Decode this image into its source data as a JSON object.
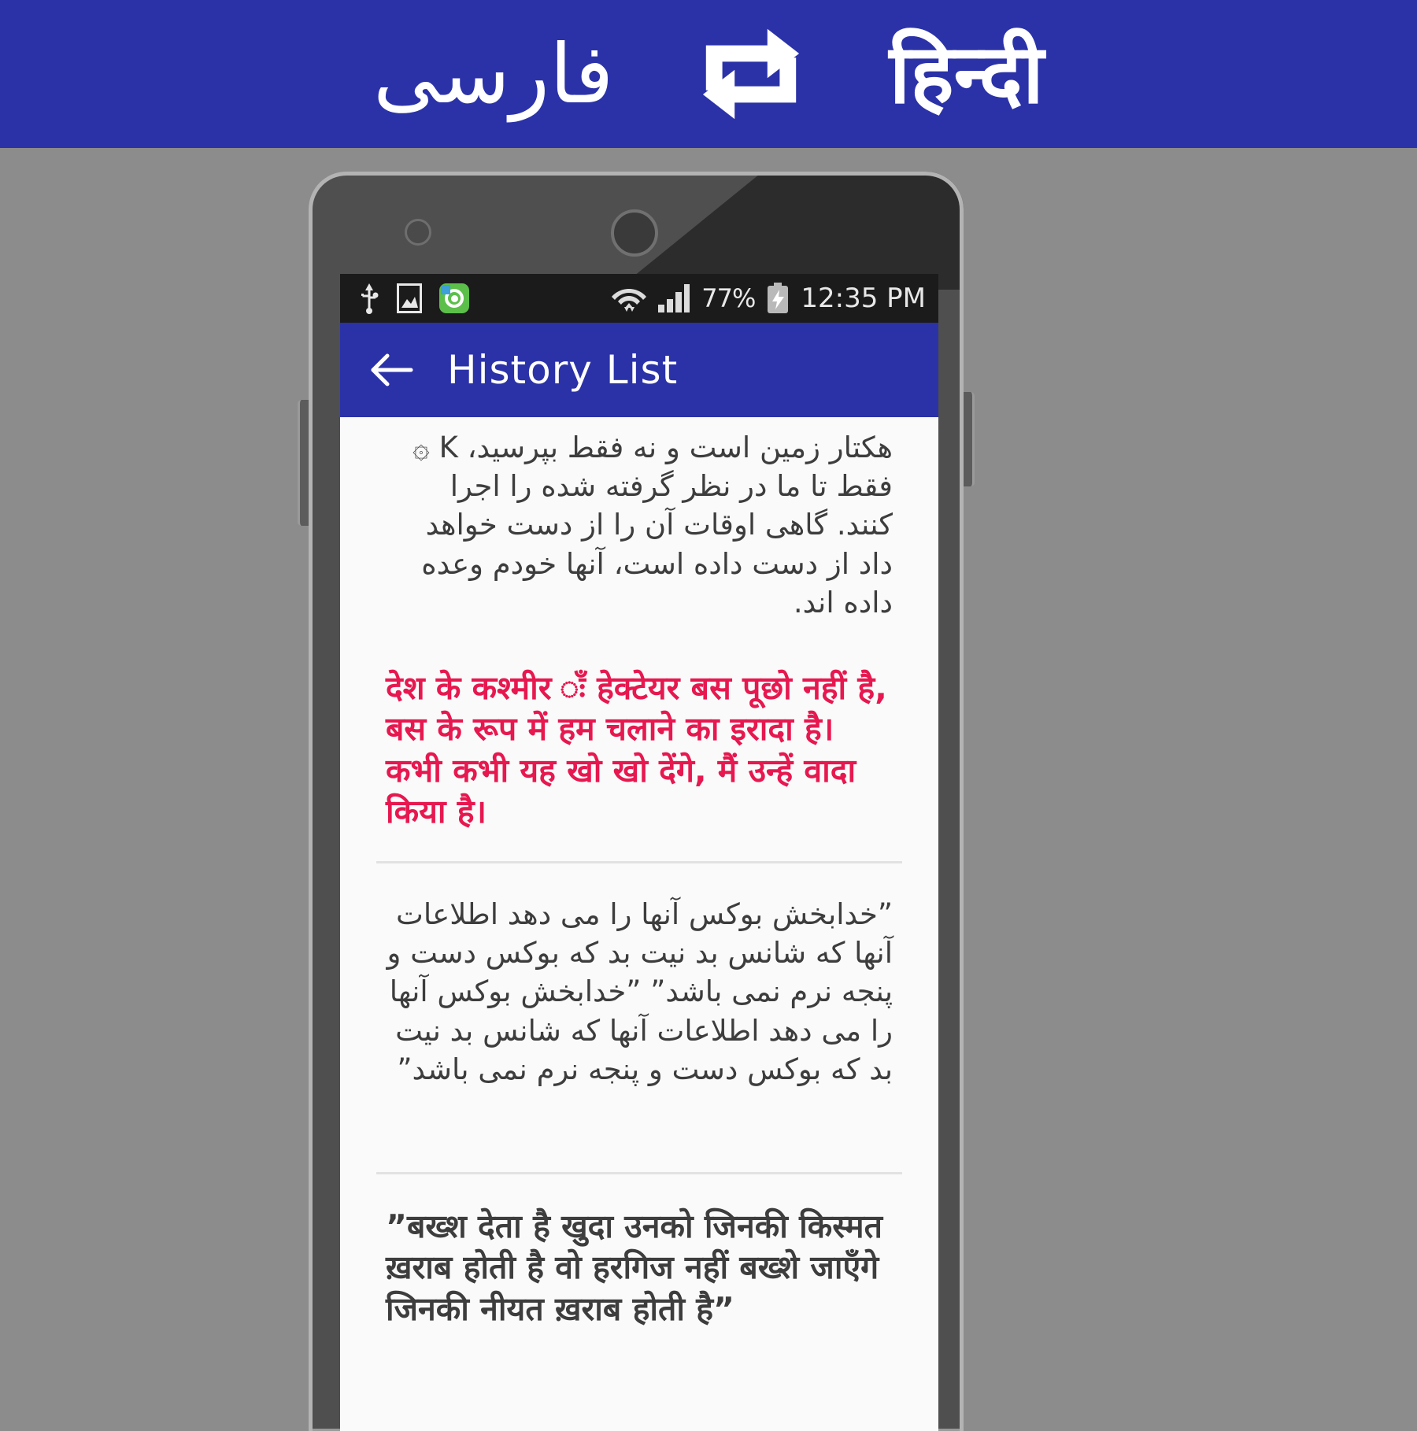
{
  "promo_banner": {
    "source_language": "فارسی",
    "swap_icon": "swap-repeat-icon",
    "target_language": "हिन्दी",
    "background_color": "#2b32a8",
    "text_color": "#ffffff"
  },
  "phone": {
    "status_bar": {
      "icons_left": [
        "usb-icon",
        "screenshot-icon",
        "app-notification-icon"
      ],
      "icons_right": [
        "wifi-icon",
        "cellular-signal-icon",
        "battery-charging-icon"
      ],
      "battery_percent": "77%",
      "time": "12:35 PM",
      "background_color": "#1b1b1b"
    },
    "app_bar": {
      "back_icon": "back-arrow-icon",
      "title": "History List",
      "background_color": "#2b32a8"
    },
    "history_list": {
      "items": [
        {
          "id": "item-1",
          "source_text": "هکتار زمین است و نه فقط بپرسید، ‏K ۞ فقط تا ما در نظر گرفته شده را اجرا کنند. گاهی اوقات آن را از دست خواهد داد از دست داده است، آنها خودم وعده داده اند.",
          "source_lang": "fa",
          "target_text": "देश के कश्मीर ःँ हेक्टेयर बस पूछो नहीं है, बस के रूप में हम चलाने का इरादा है। कभी कभी यह खो खो देंगे, मैं उन्हें वादा किया है।",
          "target_lang": "hi",
          "target_color": "#e6184f"
        },
        {
          "id": "item-2",
          "source_text": "”خدابخش بوکس آنها را می دهد اطلاعات آنها که شانس بد نیت بد که بوکس دست و پنجه نرم نمی باشد” ”خدابخش بوکس آنها را می دهد اطلاعات آنها که شانس بد نیت بد که بوکس دست و پنجه نرم نمی باشد”",
          "source_lang": "fa",
          "target_text": "",
          "target_lang": "hi",
          "target_color": "#3d3d3d"
        },
        {
          "id": "item-3",
          "source_text": "",
          "source_lang": "fa",
          "target_text": "”बख्श देता है खुदा उनको जिनकी किस्मत ख़राब होती है वो हरगिज नहीं बख्शे जाएँगे जिनकी नीयत ख़राब होती है”",
          "target_lang": "hi",
          "target_color": "#3d3d3d"
        }
      ]
    }
  },
  "colors": {
    "brand_blue": "#2b32a8",
    "accent_red": "#e6184f",
    "page_background": "#8c8c8c",
    "screen_background": "#fafafa",
    "body_text": "#3d3d3d"
  }
}
